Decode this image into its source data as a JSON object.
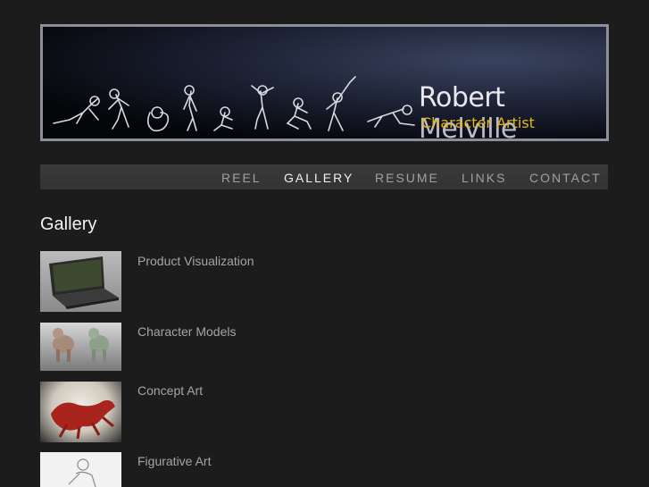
{
  "header": {
    "first_name": "Robert",
    "last_name": "Melville",
    "role": "Character Artist"
  },
  "nav": {
    "items": [
      {
        "label": "REEL",
        "active": false
      },
      {
        "label": "GALLERY",
        "active": true
      },
      {
        "label": "RESUME",
        "active": false
      },
      {
        "label": "LINKS",
        "active": false
      },
      {
        "label": "CONTACT",
        "active": false
      }
    ]
  },
  "page": {
    "title": "Gallery"
  },
  "gallery": {
    "items": [
      {
        "label": "Product Visualization",
        "thumb": "laptop-render"
      },
      {
        "label": "Character Models",
        "thumb": "creature-models"
      },
      {
        "label": "Concept Art",
        "thumb": "red-creature-concept"
      },
      {
        "label": "Figurative Art",
        "thumb": "figure-drawing"
      }
    ]
  },
  "colors": {
    "background": "#1c1c1c",
    "nav_bar": "#363636",
    "accent_gold": "#e6b41e",
    "active_nav": "#f0f0f0",
    "link_text": "#a5a5a5"
  }
}
